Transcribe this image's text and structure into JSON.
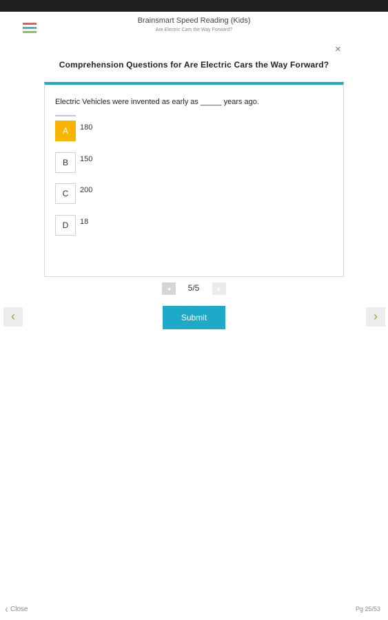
{
  "app": {
    "title": "Brainsmart Speed Reading (Kids)",
    "subtitle": "Are Electric Cars the Way Forward?"
  },
  "menu_icon": {
    "name": "list-menu-icon",
    "colors": [
      "#e8595a",
      "#3cb5d0",
      "#8ac44a"
    ]
  },
  "quiz": {
    "close_glyph": "×",
    "title": "Comprehension Questions for Are Electric Cars the Way Forward?",
    "question": "Electric Vehicles were invented as early as _____ years ago.",
    "options": [
      {
        "letter": "A",
        "text": "180",
        "selected": true
      },
      {
        "letter": "B",
        "text": "150",
        "selected": false
      },
      {
        "letter": "C",
        "text": "200",
        "selected": false
      },
      {
        "letter": "D",
        "text": "18",
        "selected": false
      }
    ],
    "pager": {
      "prev_glyph": "◂",
      "next_glyph": "▸",
      "text": "5/5"
    },
    "submit_label": "Submit"
  },
  "nav": {
    "prev_glyph": "‹",
    "next_glyph": "›"
  },
  "footer": {
    "close_label": "Close",
    "close_glyph": "‹",
    "page_label": "Pg 25/53"
  },
  "colors": {
    "accent": "#1ea9c8",
    "selected_option": "#f7b500",
    "arrow": "#9aa33a"
  }
}
